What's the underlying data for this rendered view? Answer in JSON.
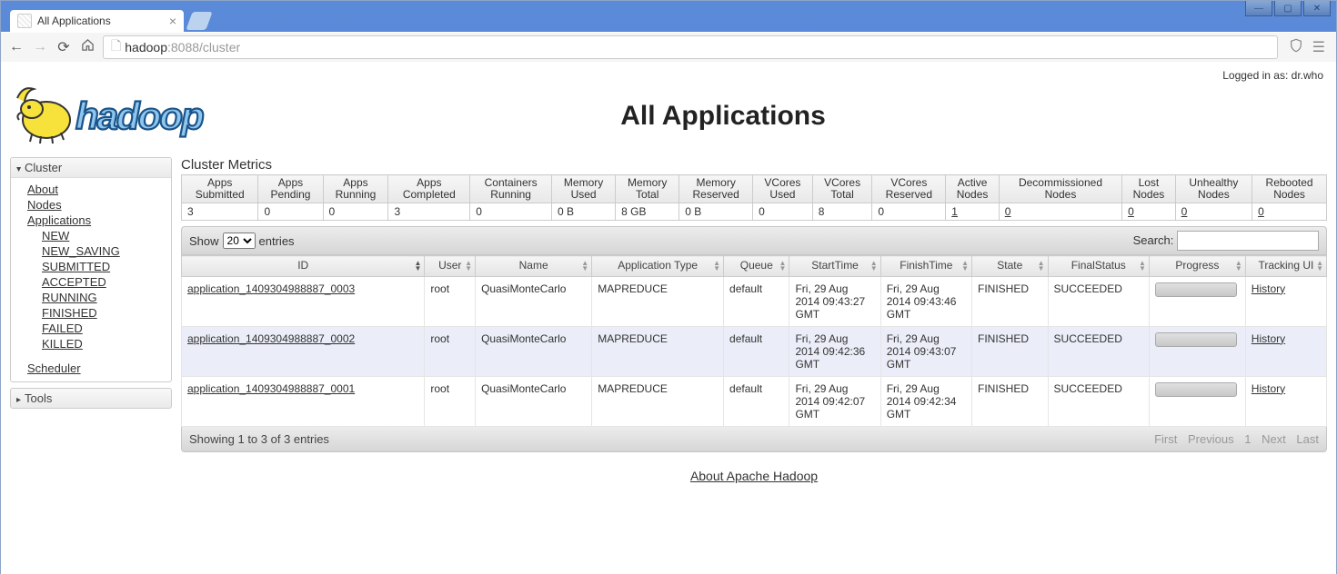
{
  "browser": {
    "tab_title": "All Applications",
    "url_host": "hadoop",
    "url_port_path": ":8088/cluster"
  },
  "login": {
    "prefix": "Logged in as: ",
    "user": "dr.who"
  },
  "page_title": "All Applications",
  "sidebar": {
    "cluster_label": "Cluster",
    "tools_label": "Tools",
    "links": {
      "about": "About",
      "nodes": "Nodes",
      "applications": "Applications",
      "scheduler": "Scheduler"
    },
    "app_states": [
      "NEW",
      "NEW_SAVING",
      "SUBMITTED",
      "ACCEPTED",
      "RUNNING",
      "FINISHED",
      "FAILED",
      "KILLED"
    ]
  },
  "metrics": {
    "title": "Cluster Metrics",
    "headers": [
      "Apps Submitted",
      "Apps Pending",
      "Apps Running",
      "Apps Completed",
      "Containers Running",
      "Memory Used",
      "Memory Total",
      "Memory Reserved",
      "VCores Used",
      "VCores Total",
      "VCores Reserved",
      "Active Nodes",
      "Decommissioned Nodes",
      "Lost Nodes",
      "Unhealthy Nodes",
      "Rebooted Nodes"
    ],
    "values": [
      "3",
      "0",
      "0",
      "3",
      "0",
      "0 B",
      "8 GB",
      "0 B",
      "0",
      "8",
      "0",
      "1",
      "0",
      "0",
      "0",
      "0"
    ],
    "link_cols": [
      11,
      12,
      13,
      14,
      15
    ]
  },
  "datatable": {
    "show_prefix": "Show",
    "show_value": "20",
    "show_suffix": "entries",
    "search_label": "Search:",
    "info": "Showing 1 to 3 of 3 entries",
    "pager": {
      "first": "First",
      "prev": "Previous",
      "page": "1",
      "next": "Next",
      "last": "Last"
    },
    "columns": [
      "ID",
      "User",
      "Name",
      "Application Type",
      "Queue",
      "StartTime",
      "FinishTime",
      "State",
      "FinalStatus",
      "Progress",
      "Tracking UI"
    ],
    "rows": [
      {
        "id": "application_1409304988887_0003",
        "user": "root",
        "name": "QuasiMonteCarlo",
        "type": "MAPREDUCE",
        "queue": "default",
        "start": "Fri, 29 Aug 2014 09:43:27 GMT",
        "finish": "Fri, 29 Aug 2014 09:43:46 GMT",
        "state": "FINISHED",
        "final": "SUCCEEDED",
        "tracking": "History"
      },
      {
        "id": "application_1409304988887_0002",
        "user": "root",
        "name": "QuasiMonteCarlo",
        "type": "MAPREDUCE",
        "queue": "default",
        "start": "Fri, 29 Aug 2014 09:42:36 GMT",
        "finish": "Fri, 29 Aug 2014 09:43:07 GMT",
        "state": "FINISHED",
        "final": "SUCCEEDED",
        "tracking": "History"
      },
      {
        "id": "application_1409304988887_0001",
        "user": "root",
        "name": "QuasiMonteCarlo",
        "type": "MAPREDUCE",
        "queue": "default",
        "start": "Fri, 29 Aug 2014 09:42:07 GMT",
        "finish": "Fri, 29 Aug 2014 09:42:34 GMT",
        "state": "FINISHED",
        "final": "SUCCEEDED",
        "tracking": "History"
      }
    ]
  },
  "footer": {
    "about_link": "About Apache Hadoop"
  }
}
